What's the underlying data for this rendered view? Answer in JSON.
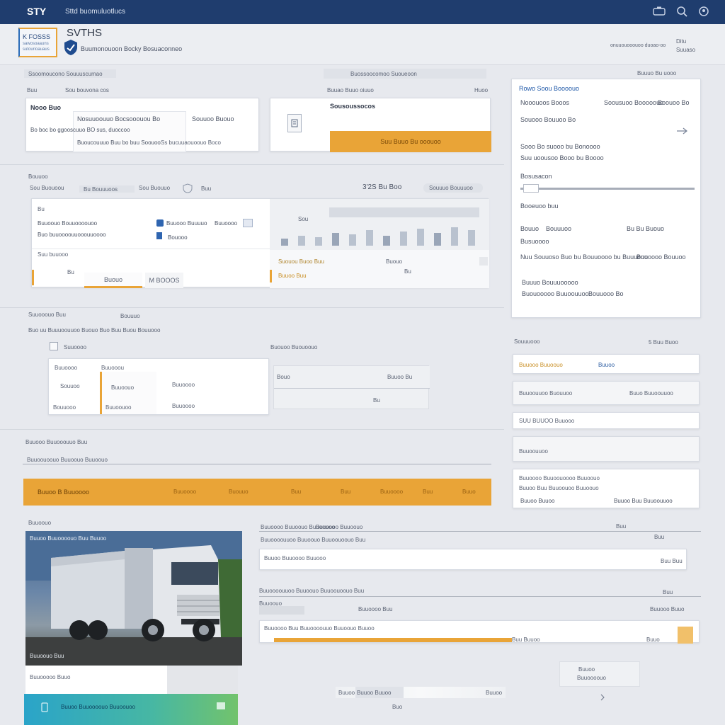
{
  "topbar": {
    "logo": "STY",
    "title": "Sttd buomuluotlucs",
    "icons": [
      "grid-icon",
      "search-icon",
      "user-icon"
    ]
  },
  "brand": {
    "box_line1": "K FOSSS",
    "box_line2": "sawosoaauns",
    "box_line3": "sutourioauaus",
    "name": "SVTHS",
    "tagline": "Buumonouoon Bocky Bosuaconneo",
    "right_line1": "Ditu",
    "right_line2": "onuuouooouoo duoao-oo",
    "right_line3": "Suuaso"
  },
  "row1": {
    "blur_left": "Ssoomoucono Souuuscumao",
    "blur_mid": "Buossoocomoo Suoueoon",
    "label_a": "Buu",
    "label_b": "Sou bouvona cos",
    "label_c": "Buuao Buuo oiuuo",
    "label_d": "Huoo",
    "card1_title": "Nooo Buo",
    "card1_l1": "Nosuuoouuo Bocsooouou Bo",
    "card1_l2": "Souuoo  Buouo",
    "card1_l3": "Bo boc bo ggooscuuo BO sus, duoccoo",
    "card1_l4": "Buoucouuuo Buu bo buu Soouoo",
    "card1_l5": "Ss bucuuaouoouo Boco",
    "card2_title": "Sousoussocos",
    "card2_btn": "Suu Buuo Bu ooouoo",
    "side_header": "Buuuo Bu uooo"
  },
  "right_panel": {
    "title": "Rowo Soou Boooouo",
    "l1a": "Nooouoos Booos",
    "l1b": "Soousuoo Booooouo",
    "l1c": "Boouoo Bo",
    "l2": "Souooo Bouuoo Bo",
    "l3": "Sooo Bo suooo bu Bonoooo",
    "l4": "Suu uoousoo Booo bu Boooo",
    "l5": "Bosusacon",
    "l6": "Booeuoo buu",
    "l7a": "Bouuo",
    "l7b": "Bouuuoo",
    "l7c": "Bu Bu Buouo",
    "l8": "Busuoooo",
    "l9a": "Nuu Souuoso Buo bu Bouuoooo bu Buuuooo",
    "l9b": "Buuoooo Bouuoo",
    "l10a": "Buuuo Bouuuooooo",
    "l10b": "Buouooooo Buuoouuoo",
    "l10c": "Bouuooo Bo"
  },
  "row2": {
    "section": "Bouuoo",
    "sub1": "Sou Buouoou",
    "sub2": "Bu Bouuuoos",
    "sub3": "Sou Buouuo",
    "sub4": "Buu",
    "sub5": "3'2S Bu Boo",
    "sub6": "Souuuo Bouuuoo",
    "card_l1": "Bu",
    "card_l2": "Buuoouo Bouuoooouoo",
    "card_l3": "Buo buuoooouuooouuoooo",
    "card_l4": "Buuooo Buuuuo",
    "card_l5": "Buuoooo",
    "card_l6": "Bouooo",
    "card_l7": "Suu buuooo",
    "badge1": "Bu",
    "badge2": "Buuoo Bu",
    "chart_label1": "Sou",
    "tab1": "Bu",
    "tab2": "Buouo",
    "tab3": "M BOOOS",
    "tab4": "Suouou Buoo Buu",
    "tab5": "Buouo",
    "tab6": "Buuoo Buu"
  },
  "row3": {
    "section": "Suuooouo Buu",
    "sub": "Bouuuo",
    "desc": "Buo uu Buuuoouuoo Buouo Buo Buu Buou Bouuooo",
    "label1": "Suuoooo",
    "label2": "Buouoo Buouoouo",
    "card_a": "Buuoooo",
    "card_b": "Buuooou",
    "card_c": "Souuoo",
    "card_d": "Buuoouo",
    "card_e": "Buuoooo",
    "card_f": "Bouuooo",
    "card_g": "Buuoouoo",
    "field1": "Bouo",
    "field2": "Buuoo Bu",
    "field3": "Bu"
  },
  "side_list": {
    "header_a": "Souuuooo",
    "header_b": "5 Buu Buoo",
    "items": [
      {
        "a": "Buuooo Buuoouo",
        "b": "Buuoo"
      },
      {
        "a": "Buuoouuoo Buouuoo",
        "b": "Buuo  Buuoouuoo"
      },
      {
        "a": "SUU BUUOO Buuooo",
        "b": ""
      },
      {
        "a": "Buuoouuoo",
        "b": ""
      }
    ],
    "box_l1": "Buuoooo Buuoouoooo Buuoouo",
    "box_l2": "Buuoo Buu Buuoouoo Buuoouo",
    "box_l3a": "Buuoo Buuoo",
    "box_l3b": "Buuoo Buu Buuoouuoo"
  },
  "row4": {
    "title": "Buuooo Buuooouuo Buu",
    "sub": "Buuoouoouo Buuoouo Buuoouo",
    "bar_label": "Buuoo B Buuoooo",
    "bar_items": [
      "Buuoooo",
      "Buouuo",
      "Buu",
      "Buuoooo",
      "Buu",
      "Buuo"
    ]
  },
  "row5": {
    "section": "Buuoouo",
    "image_caption": "Buuoo Buuoooouo Buu Buuoo",
    "image_label": "Buuoouo Buu",
    "under_image": "Buuooooo Buuo",
    "footer_card": "Buuoo Buuoooouo Buuoouoo",
    "list_header_a": "Buuoooo Buuoouo Buuoouoo",
    "list_header_b": "Buuoooo Buuoouo",
    "list_header_c": "Buu",
    "row_a": "Buuoo Buuoooo Buuooo",
    "row_a_right": "Buu Buu",
    "row_b": "Buuoooouuoo Buuoouo Buuoouoouo Buu",
    "row_c": "Buuoouo",
    "row_c2": "Buuoooo Buu",
    "row_c3": "Buuooo Buuo",
    "row_d": "Buuoooo Buu Buuoooouuo Buuoouo Buuoo",
    "row_d_mid": "Buu Buuoo",
    "row_d_right": "Buuo",
    "mini1": "Buuoo",
    "mini2": "Buuoooouo",
    "footer_pill": "Buuoo Buuoo",
    "footer_small": "Buo"
  },
  "colors": {
    "accent": "#e9a437",
    "navy": "#1f3d6e"
  }
}
